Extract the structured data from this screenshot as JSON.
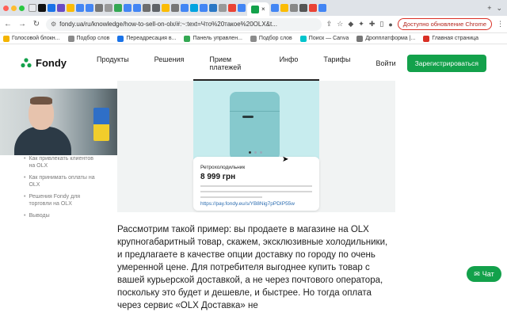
{
  "browser": {
    "active_tab_close": "×",
    "tab_controls": [
      "+",
      "⌄"
    ],
    "url": "fondy.ua/ru/knowledge/how-to-sell-on-olx/#:~:text=Что%20такое%20OLX&t...",
    "update_button": "Доступно обновление Chrome",
    "bookmarks": [
      {
        "label": "Голосовой блокн...",
        "color": "#f4b400"
      },
      {
        "label": "Подбор слов",
        "color": "#8b8b8b"
      },
      {
        "label": "Переадресация в...",
        "color": "#1a73e8"
      },
      {
        "label": "Панель управлен...",
        "color": "#34a853"
      },
      {
        "label": "Подбор слов",
        "color": "#8b8b8b"
      },
      {
        "label": "Поиск — Canva",
        "color": "#00c4cc"
      },
      {
        "label": "Дропплатформа |...",
        "color": "#777777"
      },
      {
        "label": "Главная страница",
        "color": "#d93025"
      }
    ]
  },
  "site": {
    "brand": "Fondy",
    "nav": [
      "Продукты",
      "Решения",
      "Прием платежей",
      "Инфо",
      "Тарифы"
    ],
    "login": "Войти",
    "signup": "Зарегистрироваться",
    "accent": "#13a14b"
  },
  "toc": [
    "Как привлекать клиентов на OLX",
    "Как принимать оплаты на OLX",
    "Решения Fondy для торговли на OLX",
    "Выводы"
  ],
  "product": {
    "name": "Ретрохолодильник",
    "price": "8 999 грн",
    "link": "https://pay.fondy.eu/s/YB8Nig7pPDIP55w"
  },
  "article": "Рассмотрим такой пример: вы продаете в магазине на OLX крупногабаритный товар, скажем, эксклюзивные холодильники, и предлагаете в качестве опции доставку по городу по очень умеренной цене. Для потребителя выгоднее купить товар с вашей курьерской доставкой, а не через почтового оператора, поскольку это будет и дешевле, и быстрее. Но тогда оплата через сервис «OLX Доставка» не",
  "chat": "Чат"
}
